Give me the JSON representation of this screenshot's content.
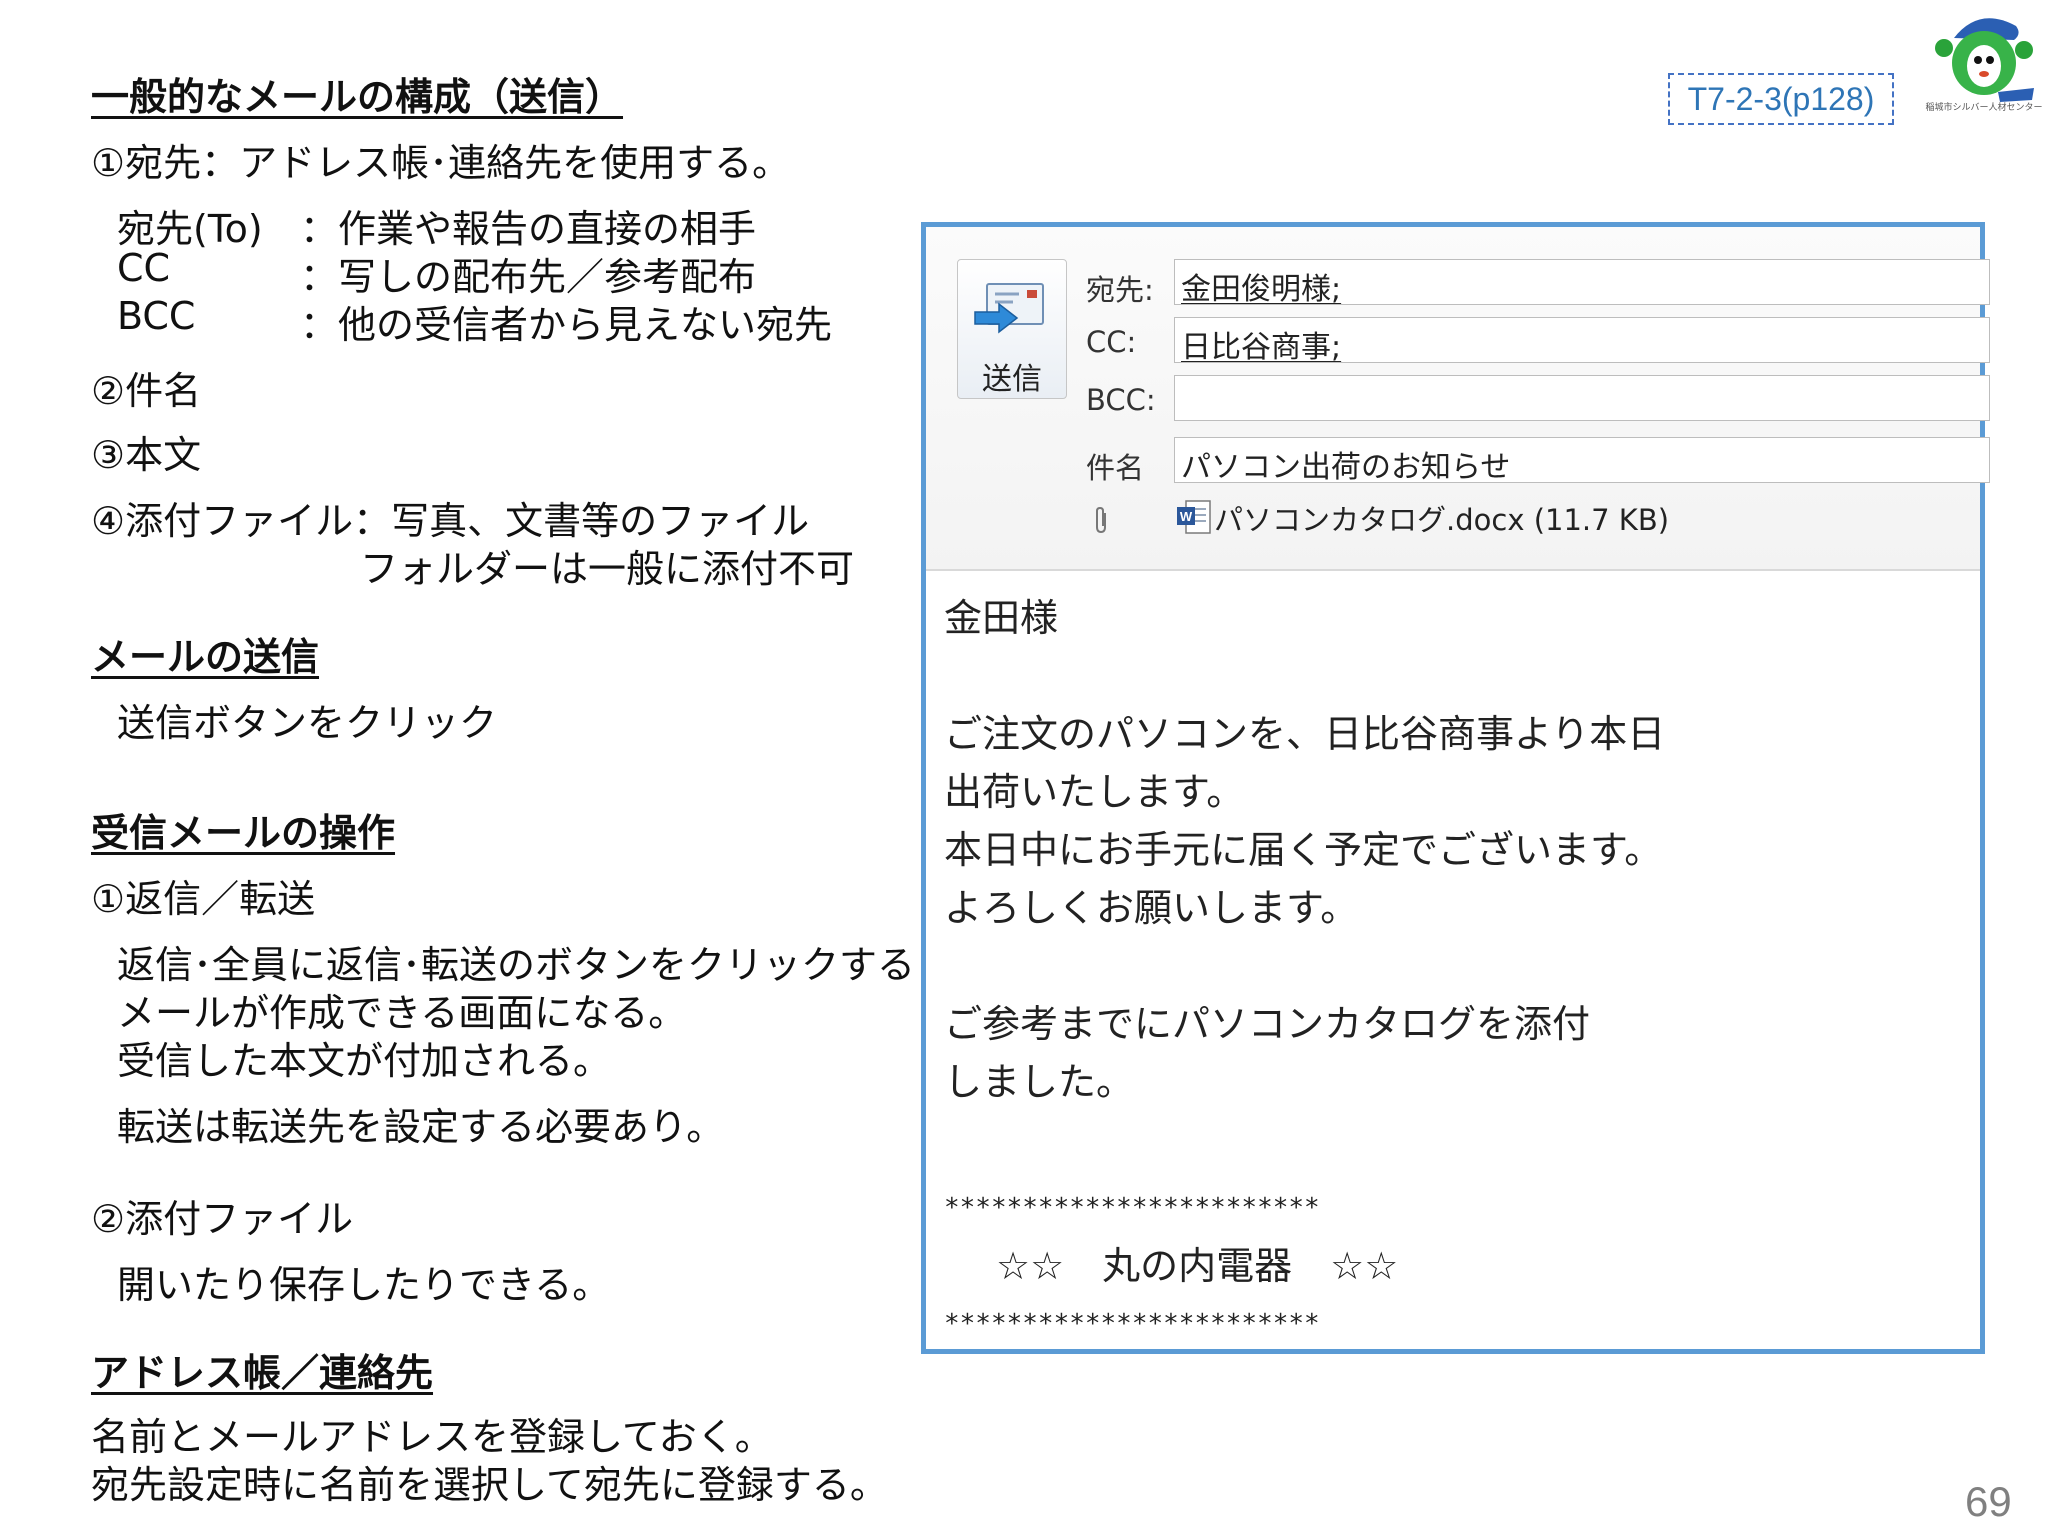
{
  "reference": "T7-2-3(p128)",
  "logo_caption": "稲城市シルバー人材センター",
  "page_number": "69",
  "left": {
    "section1": {
      "heading": "一般的なメールの構成（送信）",
      "item1": "①宛先：アドレス帳･連絡先を使用する。",
      "to_label": "宛先(To)",
      "to_desc": "：作業や報告の直接の相手",
      "cc_label": "CC",
      "cc_desc": "：写しの配布先／参考配布",
      "bcc_label": "BCC",
      "bcc_desc": "：他の受信者から見えない宛先",
      "item2": "②件名",
      "item3": "③本文",
      "item4": "④添付ファイル：写真、文書等のファイル",
      "item4_cont": "フォルダーは一般に添付不可"
    },
    "section2": {
      "heading": "メールの送信",
      "text": "送信ボタンをクリック"
    },
    "section3": {
      "heading": "受信メールの操作",
      "item1": "①返信／転送",
      "line1": "返信･全員に返信･転送のボタンをクリックすると",
      "line2": "メールが作成できる画面になる。",
      "line3": "受信した本文が付加される。",
      "line4": "転送は転送先を設定する必要あり。",
      "item2": "②添付ファイル",
      "line5": "開いたり保存したりできる。"
    },
    "section4": {
      "heading": "アドレス帳／連絡先",
      "line1": "名前とメールアドレスを登録しておく。",
      "line2": "宛先設定時に名前を選択して宛先に登録する。"
    }
  },
  "mail": {
    "send_label": "送信",
    "to_label": "宛先:",
    "to_value": "金田俊明様;",
    "cc_label": "CC:",
    "cc_value": "日比谷商事;",
    "bcc_label": "BCC:",
    "bcc_value": "",
    "subject_label": "件名",
    "subject_value": "パソコン出荷のお知らせ",
    "attachment": "パソコンカタログ.docx (11.7 KB)",
    "icons": [
      "send-icon",
      "paperclip-icon",
      "word-doc-icon"
    ],
    "body": {
      "greeting": "金田様",
      "p1": "ご注文のパソコンを、日比谷商事より本日",
      "p2": "出荷いたします。",
      "p3": "本日中にお手元に届く予定でございます。",
      "p4": "よろしくお願いします。",
      "p5": "ご参考までにパソコンカタログを添付",
      "p6": "しました。",
      "sig_top": "************************",
      "sig_name": "☆☆　丸の内電器　☆☆",
      "sig_bottom": "************************"
    }
  },
  "colors": {
    "frame": "#5b9bd5",
    "reference_text": "#2e75b6",
    "page_number": "#808080"
  }
}
